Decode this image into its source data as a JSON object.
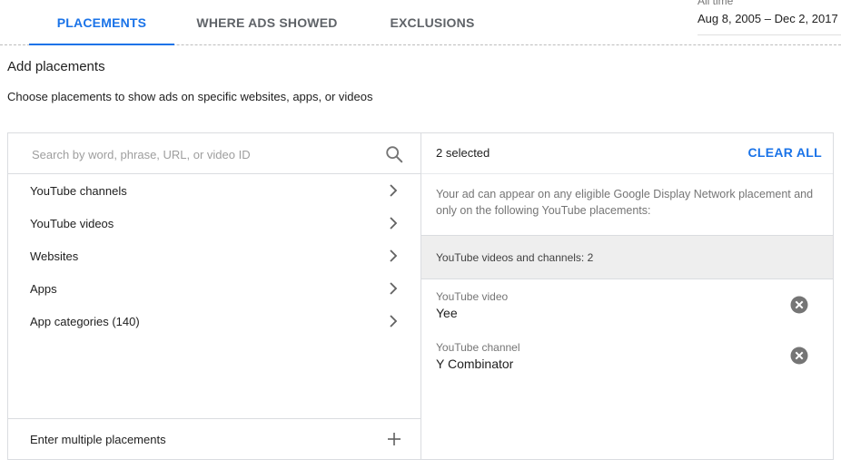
{
  "tabs": [
    {
      "label": "PLACEMENTS",
      "active": true
    },
    {
      "label": "WHERE ADS SHOWED",
      "active": false
    },
    {
      "label": "EXCLUSIONS",
      "active": false
    }
  ],
  "date_range": {
    "label": "All time",
    "value": "Aug 8, 2005 – Dec 2, 2017"
  },
  "heading": "Add placements",
  "subheading": "Choose placements to show ads on specific websites, apps, or videos",
  "search": {
    "placeholder": "Search by word, phrase, URL, or video ID",
    "icon": "search-icon"
  },
  "categories": [
    {
      "label": "YouTube channels"
    },
    {
      "label": "YouTube videos"
    },
    {
      "label": "Websites"
    },
    {
      "label": "Apps"
    },
    {
      "label": "App categories (140)"
    }
  ],
  "enter_multiple": "Enter multiple placements",
  "selection": {
    "count_text": "2 selected",
    "clear_all": "CLEAR ALL",
    "note": "Your ad can appear on any eligible Google Display Network placement and only on the following YouTube placements:",
    "group_label": "YouTube videos and channels: 2",
    "items": [
      {
        "type": "YouTube video",
        "name": "Yee"
      },
      {
        "type": "YouTube channel",
        "name": "Y Combinator"
      }
    ]
  },
  "colors": {
    "accent": "#1a73e8",
    "group_bg": "#eeeeee",
    "border": "#dadce0"
  }
}
